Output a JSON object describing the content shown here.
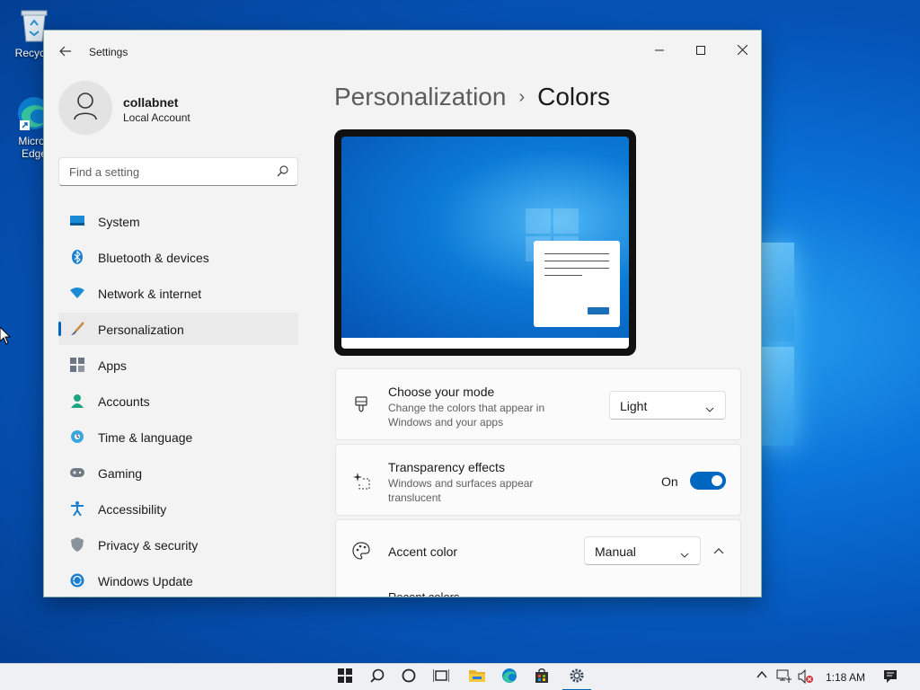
{
  "desktop": {
    "icons": [
      {
        "label": "Recycle",
        "icon": "recycle-bin-icon"
      },
      {
        "label": "Micros Edge",
        "icon": "edge-icon"
      }
    ]
  },
  "window": {
    "title": "Settings",
    "back_icon": "back-arrow-icon",
    "controls": [
      "minimize-icon",
      "maximize-icon",
      "close-icon"
    ]
  },
  "profile": {
    "name": "collabnet",
    "account_type": "Local Account"
  },
  "search": {
    "placeholder": "Find a setting"
  },
  "nav": {
    "items": [
      {
        "label": "System",
        "icon": "system-icon"
      },
      {
        "label": "Bluetooth & devices",
        "icon": "bluetooth-icon"
      },
      {
        "label": "Network & internet",
        "icon": "wifi-icon"
      },
      {
        "label": "Personalization",
        "icon": "brush-icon",
        "active": true
      },
      {
        "label": "Apps",
        "icon": "apps-icon"
      },
      {
        "label": "Accounts",
        "icon": "accounts-icon"
      },
      {
        "label": "Time & language",
        "icon": "globe-icon"
      },
      {
        "label": "Gaming",
        "icon": "gamepad-icon"
      },
      {
        "label": "Accessibility",
        "icon": "accessibility-icon"
      },
      {
        "label": "Privacy & security",
        "icon": "shield-icon"
      },
      {
        "label": "Windows Update",
        "icon": "update-icon"
      }
    ]
  },
  "breadcrumb": {
    "parent": "Personalization",
    "separator": "›",
    "current": "Colors"
  },
  "settings": {
    "mode": {
      "title": "Choose your mode",
      "description": "Change the colors that appear in Windows and your apps",
      "value": "Light"
    },
    "transparency": {
      "title": "Transparency effects",
      "description": "Windows and surfaces appear translucent",
      "state_label": "On",
      "enabled": true
    },
    "accent": {
      "title": "Accent color",
      "value": "Manual",
      "sub_label": "Recent colors"
    }
  },
  "taskbar": {
    "icons": [
      "start-icon",
      "search-icon",
      "cortana-icon",
      "task-view-icon",
      "file-explorer-icon",
      "edge-icon",
      "store-icon",
      "settings-icon"
    ],
    "time": "1:18 AM"
  },
  "colors": {
    "accent": "#0067c0",
    "window_bg": "#f3f3f3",
    "card_bg": "#fbfbfb"
  }
}
